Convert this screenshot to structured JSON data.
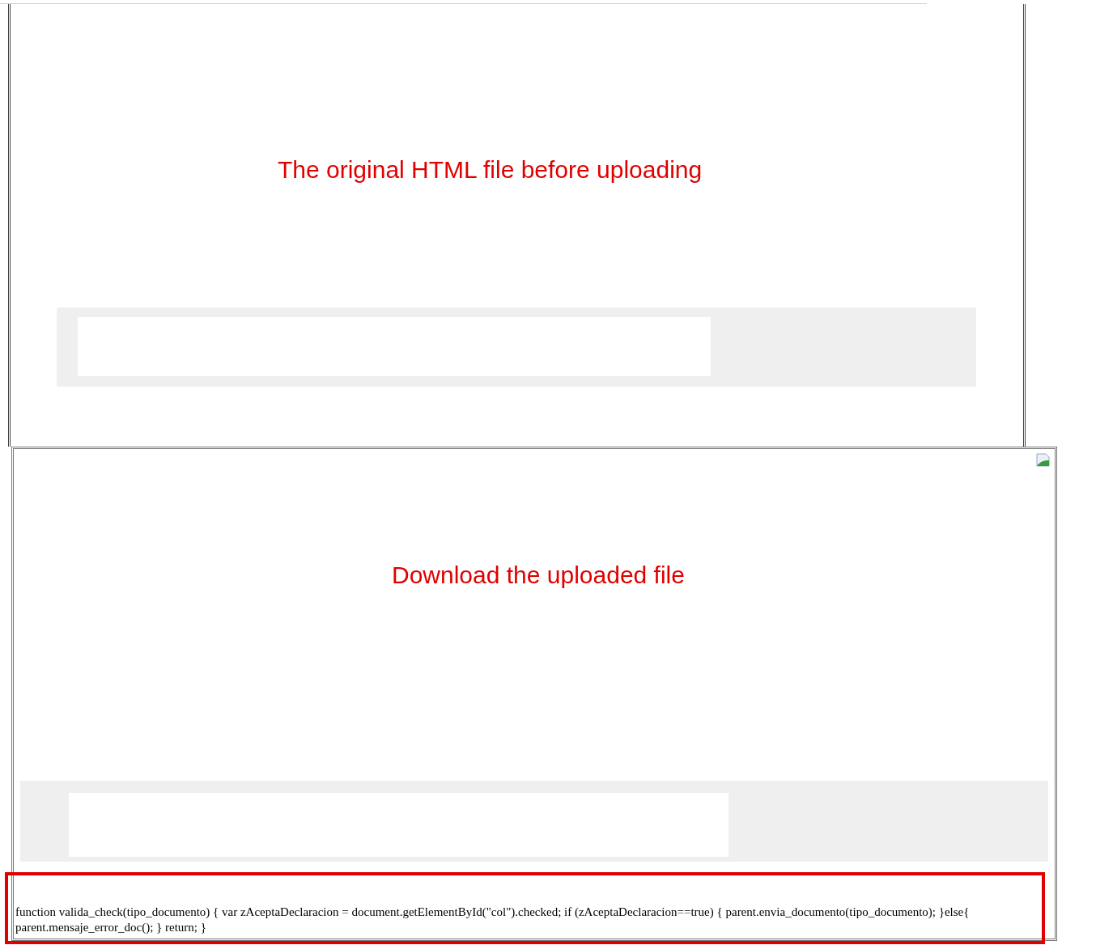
{
  "panels": [
    {
      "annotation": "The original HTML file before uploading"
    },
    {
      "annotation": "Download the uploaded file",
      "code": "function valida_check(tipo_documento) { var zAceptaDeclaracion = document.getElementById(\"col\").checked; if (zAceptaDeclaracion==true) { parent.envia_documento(tipo_documento); }else{ parent.mensaje_error_doc(); } return; }"
    }
  ]
}
